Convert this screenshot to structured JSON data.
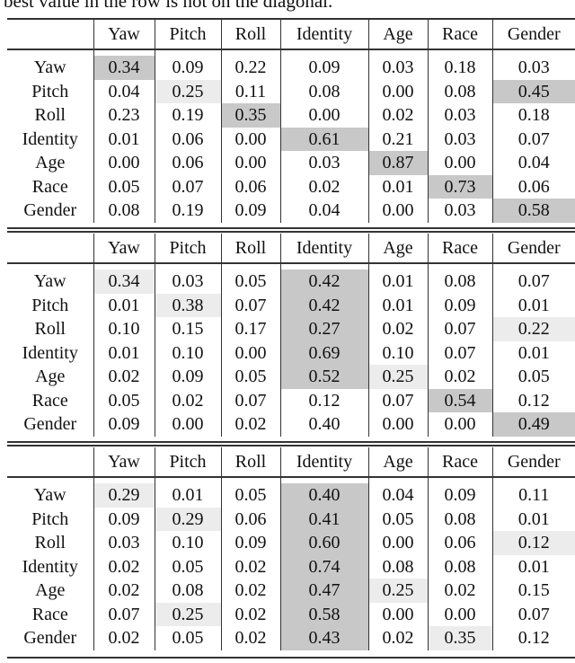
{
  "caption": "best value in the row is not on the diagonal.",
  "columns": [
    "",
    "Yaw",
    "Pitch",
    "Roll",
    "Identity",
    "Age",
    "Race",
    "Gender"
  ],
  "tables": [
    {
      "rows": [
        {
          "label": "Yaw",
          "cells": [
            {
              "v": "0.34",
              "b": 1,
              "s": "dark"
            },
            {
              "v": "0.09"
            },
            {
              "v": "0.22"
            },
            {
              "v": "0.09"
            },
            {
              "v": "0.03"
            },
            {
              "v": "0.18"
            },
            {
              "v": "0.03"
            }
          ]
        },
        {
          "label": "Pitch",
          "cells": [
            {
              "v": "0.04"
            },
            {
              "v": "0.25",
              "b": 1,
              "s": "light"
            },
            {
              "v": "0.11"
            },
            {
              "v": "0.08"
            },
            {
              "v": "0.00"
            },
            {
              "v": "0.08"
            },
            {
              "v": "0.45",
              "b": 1,
              "s": "dark"
            }
          ]
        },
        {
          "label": "Roll",
          "cells": [
            {
              "v": "0.23"
            },
            {
              "v": "0.19"
            },
            {
              "v": "0.35",
              "b": 1,
              "s": "dark"
            },
            {
              "v": "0.00"
            },
            {
              "v": "0.02"
            },
            {
              "v": "0.03"
            },
            {
              "v": "0.18"
            }
          ]
        },
        {
          "label": "Identity",
          "cells": [
            {
              "v": "0.01"
            },
            {
              "v": "0.06"
            },
            {
              "v": "0.00"
            },
            {
              "v": "0.61",
              "b": 1,
              "s": "dark"
            },
            {
              "v": "0.21"
            },
            {
              "v": "0.03"
            },
            {
              "v": "0.07"
            }
          ]
        },
        {
          "label": "Age",
          "cells": [
            {
              "v": "0.00"
            },
            {
              "v": "0.06"
            },
            {
              "v": "0.00"
            },
            {
              "v": "0.03"
            },
            {
              "v": "0.87",
              "b": 1,
              "s": "dark"
            },
            {
              "v": "0.00"
            },
            {
              "v": "0.04"
            }
          ]
        },
        {
          "label": "Race",
          "cells": [
            {
              "v": "0.05"
            },
            {
              "v": "0.07"
            },
            {
              "v": "0.06"
            },
            {
              "v": "0.02"
            },
            {
              "v": "0.01"
            },
            {
              "v": "0.73",
              "b": 1,
              "s": "dark"
            },
            {
              "v": "0.06"
            }
          ]
        },
        {
          "label": "Gender",
          "cells": [
            {
              "v": "0.08"
            },
            {
              "v": "0.19"
            },
            {
              "v": "0.09"
            },
            {
              "v": "0.04"
            },
            {
              "v": "0.00"
            },
            {
              "v": "0.03"
            },
            {
              "v": "0.58",
              "b": 1,
              "s": "dark"
            }
          ]
        }
      ]
    },
    {
      "rows": [
        {
          "label": "Yaw",
          "cells": [
            {
              "v": "0.34",
              "b": 1,
              "s": "light"
            },
            {
              "v": "0.03"
            },
            {
              "v": "0.05"
            },
            {
              "v": "0.42",
              "b": 1,
              "s": "dark"
            },
            {
              "v": "0.01"
            },
            {
              "v": "0.08"
            },
            {
              "v": "0.07"
            }
          ]
        },
        {
          "label": "Pitch",
          "cells": [
            {
              "v": "0.01"
            },
            {
              "v": "0.38",
              "b": 1,
              "s": "light"
            },
            {
              "v": "0.07"
            },
            {
              "v": "0.42",
              "b": 1,
              "s": "dark"
            },
            {
              "v": "0.01"
            },
            {
              "v": "0.09"
            },
            {
              "v": "0.01"
            }
          ]
        },
        {
          "label": "Roll",
          "cells": [
            {
              "v": "0.10"
            },
            {
              "v": "0.15"
            },
            {
              "v": "0.17"
            },
            {
              "v": "0.27",
              "b": 1,
              "s": "dark"
            },
            {
              "v": "0.02"
            },
            {
              "v": "0.07"
            },
            {
              "v": "0.22",
              "b": 1,
              "s": "light"
            }
          ]
        },
        {
          "label": "Identity",
          "cells": [
            {
              "v": "0.01"
            },
            {
              "v": "0.10"
            },
            {
              "v": "0.00"
            },
            {
              "v": "0.69",
              "b": 1,
              "s": "dark"
            },
            {
              "v": "0.10"
            },
            {
              "v": "0.07"
            },
            {
              "v": "0.01"
            }
          ]
        },
        {
          "label": "Age",
          "cells": [
            {
              "v": "0.02"
            },
            {
              "v": "0.09"
            },
            {
              "v": "0.05"
            },
            {
              "v": "0.52",
              "b": 1,
              "s": "dark"
            },
            {
              "v": "0.25",
              "b": 1,
              "s": "light"
            },
            {
              "v": "0.02"
            },
            {
              "v": "0.05"
            }
          ]
        },
        {
          "label": "Race",
          "cells": [
            {
              "v": "0.05"
            },
            {
              "v": "0.02"
            },
            {
              "v": "0.07"
            },
            {
              "v": "0.12"
            },
            {
              "v": "0.07"
            },
            {
              "v": "0.54",
              "b": 1,
              "s": "dark"
            },
            {
              "v": "0.12"
            }
          ]
        },
        {
          "label": "Gender",
          "cells": [
            {
              "v": "0.09"
            },
            {
              "v": "0.00"
            },
            {
              "v": "0.02"
            },
            {
              "v": "0.40"
            },
            {
              "v": "0.00"
            },
            {
              "v": "0.00"
            },
            {
              "v": "0.49",
              "b": 1,
              "s": "dark"
            }
          ]
        }
      ]
    },
    {
      "rows": [
        {
          "label": "Yaw",
          "cells": [
            {
              "v": "0.29",
              "b": 1,
              "s": "light"
            },
            {
              "v": "0.01"
            },
            {
              "v": "0.05"
            },
            {
              "v": "0.40",
              "b": 1,
              "s": "dark"
            },
            {
              "v": "0.04"
            },
            {
              "v": "0.09"
            },
            {
              "v": "0.11"
            }
          ]
        },
        {
          "label": "Pitch",
          "cells": [
            {
              "v": "0.09"
            },
            {
              "v": "0.29",
              "b": 1,
              "s": "light"
            },
            {
              "v": "0.06"
            },
            {
              "v": "0.41",
              "b": 1,
              "s": "dark"
            },
            {
              "v": "0.05"
            },
            {
              "v": "0.08"
            },
            {
              "v": "0.01"
            }
          ]
        },
        {
          "label": "Roll",
          "cells": [
            {
              "v": "0.03"
            },
            {
              "v": "0.10"
            },
            {
              "v": "0.09"
            },
            {
              "v": "0.60",
              "b": 1,
              "s": "dark"
            },
            {
              "v": "0.00"
            },
            {
              "v": "0.06"
            },
            {
              "v": "0.12",
              "b": 1,
              "s": "light"
            }
          ]
        },
        {
          "label": "Identity",
          "cells": [
            {
              "v": "0.02"
            },
            {
              "v": "0.05"
            },
            {
              "v": "0.02"
            },
            {
              "v": "0.74",
              "b": 1,
              "s": "dark"
            },
            {
              "v": "0.08"
            },
            {
              "v": "0.08"
            },
            {
              "v": "0.01"
            }
          ]
        },
        {
          "label": "Age",
          "cells": [
            {
              "v": "0.02"
            },
            {
              "v": "0.08"
            },
            {
              "v": "0.02"
            },
            {
              "v": "0.47",
              "b": 1,
              "s": "dark"
            },
            {
              "v": "0.25",
              "b": 1,
              "s": "light"
            },
            {
              "v": "0.02"
            },
            {
              "v": "0.15"
            }
          ]
        },
        {
          "label": "Race",
          "cells": [
            {
              "v": "0.07"
            },
            {
              "v": "0.25",
              "b": 1,
              "s": "light"
            },
            {
              "v": "0.02"
            },
            {
              "v": "0.58",
              "b": 1,
              "s": "dark"
            },
            {
              "v": "0.00"
            },
            {
              "v": "0.00"
            },
            {
              "v": "0.07"
            }
          ]
        },
        {
          "label": "Gender",
          "cells": [
            {
              "v": "0.02"
            },
            {
              "v": "0.05"
            },
            {
              "v": "0.02"
            },
            {
              "v": "0.43",
              "b": 1,
              "s": "dark"
            },
            {
              "v": "0.02"
            },
            {
              "v": "0.35",
              "b": 1,
              "s": "light"
            },
            {
              "v": "0.12"
            }
          ]
        }
      ]
    }
  ]
}
